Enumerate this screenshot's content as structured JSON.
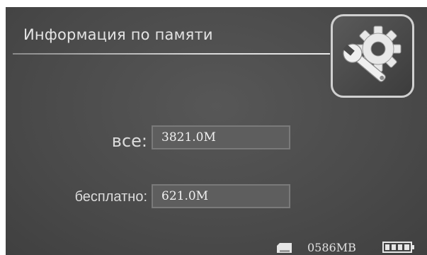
{
  "header": {
    "title": "Информация по памяти",
    "settings_icon": "gear-wrench-icon"
  },
  "memory": {
    "total_label": "все:",
    "total_value": "3821.0M",
    "free_label": "бесплатно:",
    "free_value": "621.0M"
  },
  "status": {
    "storage_icon": "sd-card-icon",
    "storage_text": "0586MB",
    "battery_icon": "battery-icon",
    "battery_level": 1.0
  },
  "colors": {
    "background": "#4a4a4a",
    "text": "#e4e4e4",
    "field_bg": "#5e5e5e"
  }
}
